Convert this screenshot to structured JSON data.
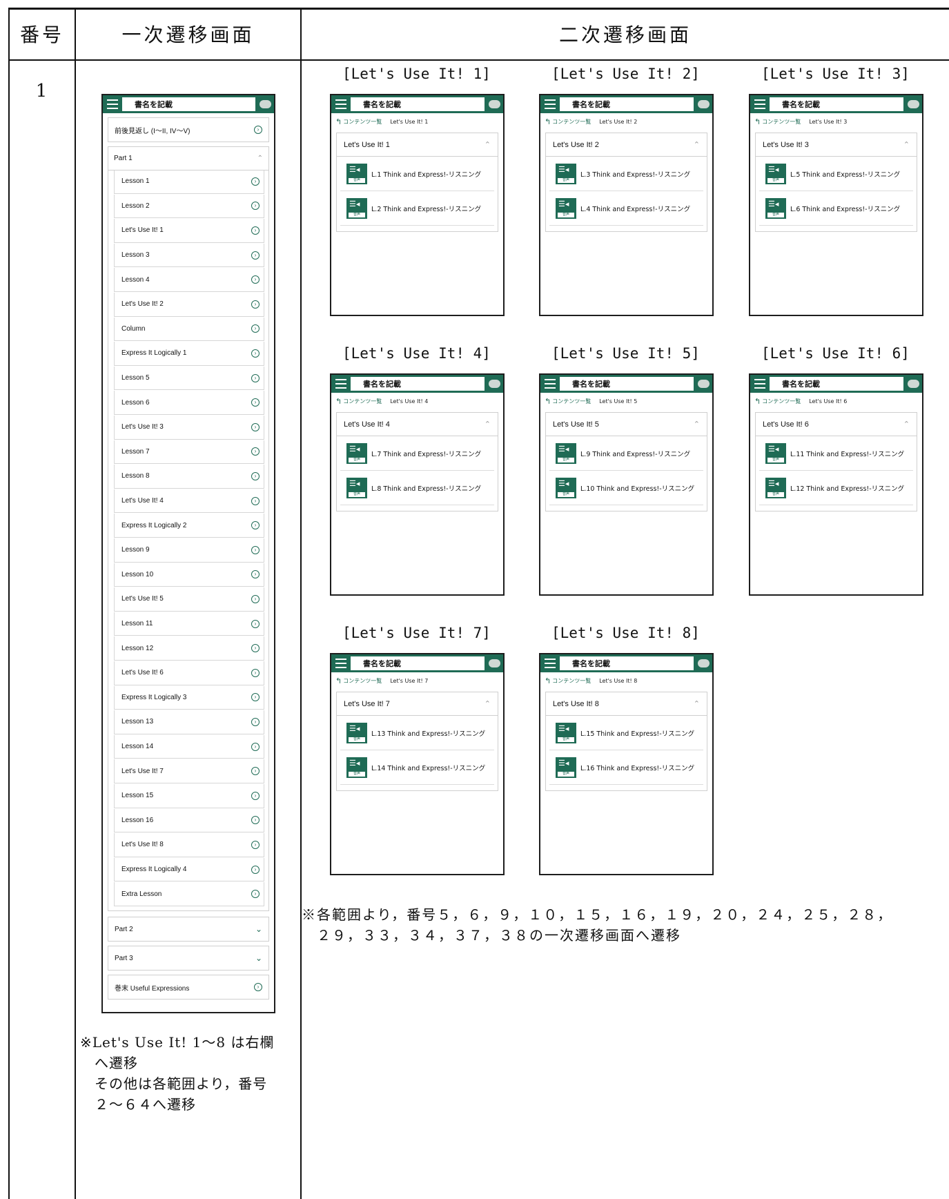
{
  "table": {
    "header": {
      "col_number": "番号",
      "col_primary": "一次遷移画面",
      "col_secondary": "二次遷移画面"
    },
    "row_number": "1"
  },
  "app": {
    "book_title": "書名を記載",
    "breadcrumb_home": "コンテンツ一覧",
    "audio_label": "音声"
  },
  "primary_screen": {
    "items": [
      {
        "label": "前後見返し (I〜II, IV〜V)",
        "type": "link"
      },
      {
        "label": "Part 1",
        "type": "open"
      },
      {
        "label": "Lesson 1"
      },
      {
        "label": "Lesson 2"
      },
      {
        "label": "Let's Use It! 1"
      },
      {
        "label": "Lesson 3"
      },
      {
        "label": "Lesson 4"
      },
      {
        "label": "Let's Use It! 2"
      },
      {
        "label": "Column"
      },
      {
        "label": "Express It Logically 1"
      },
      {
        "label": "Lesson 5"
      },
      {
        "label": "Lesson 6"
      },
      {
        "label": "Let's Use It! 3"
      },
      {
        "label": "Lesson 7"
      },
      {
        "label": "Lesson 8"
      },
      {
        "label": "Let's Use It! 4"
      },
      {
        "label": "Express It Logically 2"
      },
      {
        "label": "Lesson 9"
      },
      {
        "label": "Lesson 10"
      },
      {
        "label": "Let's Use It! 5"
      },
      {
        "label": "Lesson 11"
      },
      {
        "label": "Lesson 12"
      },
      {
        "label": "Let's Use It! 6"
      },
      {
        "label": "Express It Logically 3"
      },
      {
        "label": "Lesson 13"
      },
      {
        "label": "Lesson 14"
      },
      {
        "label": "Let's Use It! 7"
      },
      {
        "label": "Lesson 15"
      },
      {
        "label": "Lesson 16"
      },
      {
        "label": "Let's Use It! 8"
      },
      {
        "label": "Express It Logically 4"
      },
      {
        "label": "Extra Lesson"
      },
      {
        "label": "Part 2",
        "type": "collapsed"
      },
      {
        "label": "Part 3",
        "type": "collapsed"
      },
      {
        "label": "巻末 Useful Expressions",
        "type": "link"
      }
    ],
    "note": "※Let's Use It! 1〜8 は右欄\n　へ遷移\n　その他は各範囲より，番号\n　２〜６４へ遷移"
  },
  "secondary_screens": [
    {
      "caption": "[Let's Use It! 1]",
      "section": "Let's Use It! 1",
      "items": [
        "L.1 Think and Express!-リスニング",
        "L.2 Think and Express!-リスニング"
      ]
    },
    {
      "caption": "[Let's Use It! 2]",
      "section": "Let's Use It! 2",
      "items": [
        "L.3 Think and Express!-リスニング",
        "L.4 Think and Express!-リスニング"
      ]
    },
    {
      "caption": "[Let's Use It! 3]",
      "section": "Let's Use It! 3",
      "items": [
        "L.5 Think and Express!-リスニング",
        "L.6 Think and Express!-リスニング"
      ]
    },
    {
      "caption": "[Let's Use It! 4]",
      "section": "Let's Use It! 4",
      "items": [
        "L.7 Think and Express!-リスニング",
        "L.8 Think and Express!-リスニング"
      ]
    },
    {
      "caption": "[Let's Use It! 5]",
      "section": "Let's Use It! 5",
      "items": [
        "L.9 Think and Express!-リスニング",
        "L.10 Think and Express!-リスニング"
      ]
    },
    {
      "caption": "[Let's Use It! 6]",
      "section": "Let's Use It! 6",
      "items": [
        "L.11 Think and Express!-リスニング",
        "L.12 Think and Express!-リスニング"
      ]
    },
    {
      "caption": "[Let's Use It! 7]",
      "section": "Let's Use It! 7",
      "items": [
        "L.13 Think and Express!-リスニング",
        "L.14 Think and Express!-リスニング"
      ]
    },
    {
      "caption": "[Let's Use It! 8]",
      "section": "Let's Use It! 8",
      "items": [
        "L.15 Think and Express!-リスニング",
        "L.16 Think and Express!-リスニング"
      ]
    }
  ],
  "secondary_note": "※各範囲より，番号５，６，９，１０，１５，１６，１９，２０，２４，２５，２８，\n　２９，３３，３４，３７，３８の一次遷移画面へ遷移",
  "colors": {
    "accent": "#1f6b55",
    "border": "#111111"
  },
  "icons": [
    "hamburger-menu-icon",
    "toggle-pill-icon",
    "back-arrow-icon",
    "chevron-circle-right-icon",
    "chevron-up-icon",
    "chevron-down-icon",
    "audio-icon"
  ]
}
